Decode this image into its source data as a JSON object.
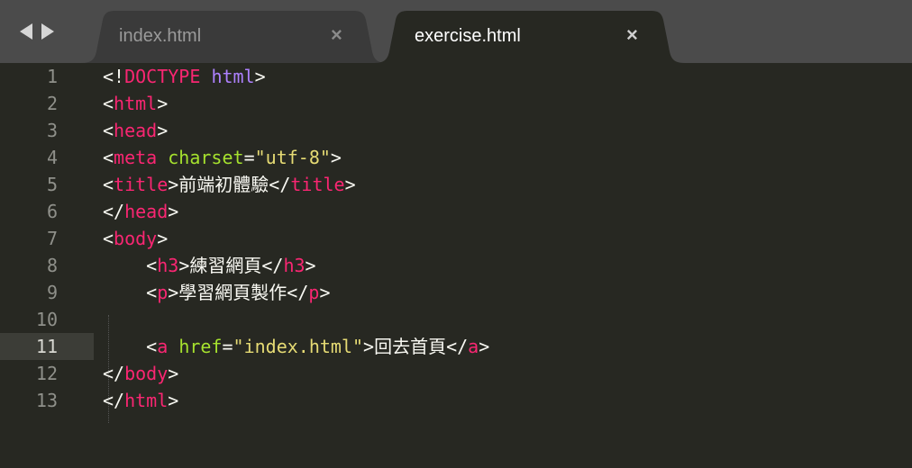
{
  "nav": {
    "back_icon": "chevron-left-icon",
    "forward_icon": "chevron-right-icon"
  },
  "tabs": [
    {
      "label": "index.html",
      "close": "×",
      "active": false
    },
    {
      "label": "exercise.html",
      "close": "×",
      "active": true
    }
  ],
  "colors": {
    "background": "#272822",
    "tag": "#f92672",
    "attribute": "#a6e22e",
    "string": "#e6db74",
    "doctype": "#ae81ff",
    "text": "#f8f8f2",
    "titlebar": "#4b4b4b"
  },
  "editor": {
    "active_line": 11,
    "lines": [
      {
        "n": "1",
        "tokens": [
          [
            "p",
            "<!"
          ],
          [
            "t",
            "DOCTYPE"
          ],
          [
            "p",
            " "
          ],
          [
            "d",
            "html"
          ],
          [
            "p",
            ">"
          ]
        ]
      },
      {
        "n": "2",
        "tokens": [
          [
            "p",
            "<"
          ],
          [
            "t",
            "html"
          ],
          [
            "p",
            ">"
          ]
        ]
      },
      {
        "n": "3",
        "tokens": [
          [
            "p",
            "<"
          ],
          [
            "t",
            "head"
          ],
          [
            "p",
            ">"
          ]
        ]
      },
      {
        "n": "4",
        "tokens": [
          [
            "p",
            "<"
          ],
          [
            "t",
            "meta"
          ],
          [
            "p",
            " "
          ],
          [
            "a",
            "charset"
          ],
          [
            "p",
            "="
          ],
          [
            "s",
            "\"utf-8\""
          ],
          [
            "p",
            ">"
          ]
        ]
      },
      {
        "n": "5",
        "tokens": [
          [
            "p",
            "<"
          ],
          [
            "t",
            "title"
          ],
          [
            "p",
            ">前端初體驗</"
          ],
          [
            "t",
            "title"
          ],
          [
            "p",
            ">"
          ]
        ]
      },
      {
        "n": "6",
        "tokens": [
          [
            "p",
            "</"
          ],
          [
            "t",
            "head"
          ],
          [
            "p",
            ">"
          ]
        ]
      },
      {
        "n": "7",
        "tokens": [
          [
            "p",
            "<"
          ],
          [
            "t",
            "body"
          ],
          [
            "p",
            ">"
          ]
        ]
      },
      {
        "n": "8",
        "tokens": [
          [
            "p",
            "    <"
          ],
          [
            "t",
            "h3"
          ],
          [
            "p",
            ">練習網頁</"
          ],
          [
            "t",
            "h3"
          ],
          [
            "p",
            ">"
          ]
        ]
      },
      {
        "n": "9",
        "tokens": [
          [
            "p",
            "    <"
          ],
          [
            "t",
            "p"
          ],
          [
            "p",
            ">學習網頁製作</"
          ],
          [
            "t",
            "p"
          ],
          [
            "p",
            ">"
          ]
        ]
      },
      {
        "n": "10",
        "tokens": []
      },
      {
        "n": "11",
        "tokens": [
          [
            "p",
            "    <"
          ],
          [
            "t",
            "a"
          ],
          [
            "p",
            " "
          ],
          [
            "a",
            "href"
          ],
          [
            "p",
            "="
          ],
          [
            "s",
            "\"index.html\""
          ],
          [
            "p",
            ">回去首頁</"
          ],
          [
            "t",
            "a"
          ],
          [
            "p",
            ">"
          ]
        ]
      },
      {
        "n": "12",
        "tokens": [
          [
            "p",
            "</"
          ],
          [
            "t",
            "body"
          ],
          [
            "p",
            ">"
          ]
        ]
      },
      {
        "n": "13",
        "tokens": [
          [
            "p",
            "</"
          ],
          [
            "t",
            "html"
          ],
          [
            "p",
            ">"
          ]
        ]
      }
    ]
  }
}
